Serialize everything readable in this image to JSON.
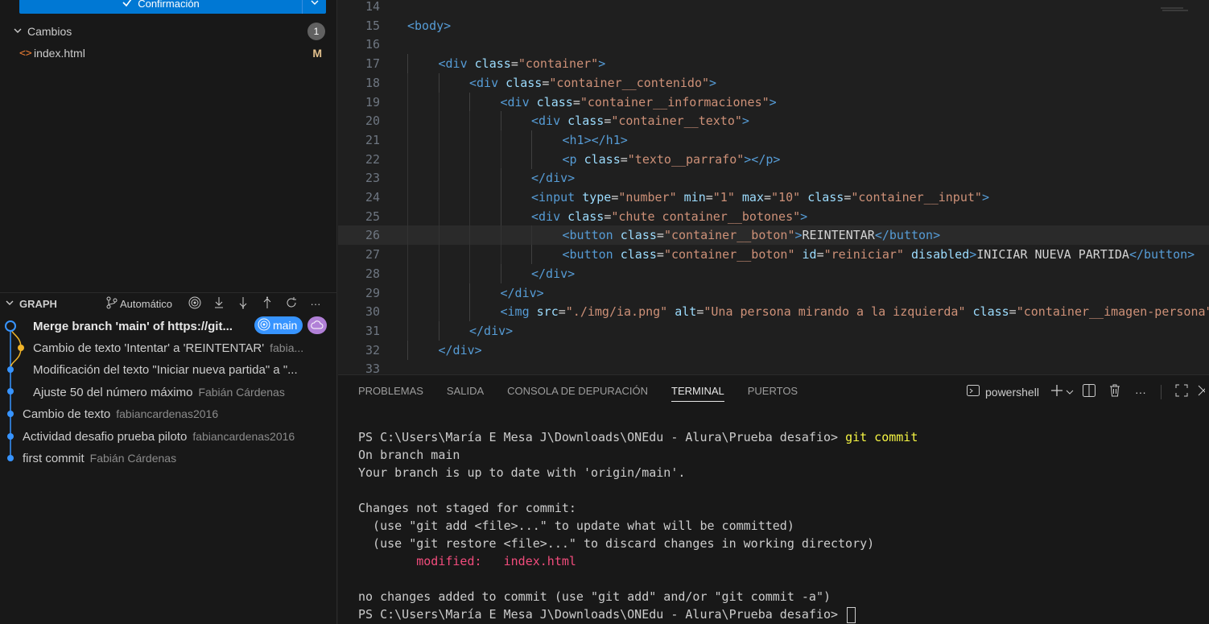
{
  "sidebar": {
    "commit_button": "Confirmación",
    "changes": {
      "label": "Cambios",
      "count": "1"
    },
    "files": [
      {
        "name": "index.html",
        "status": "M"
      }
    ],
    "graph": {
      "title": "GRAPH",
      "mode": "Automático",
      "branch": "main",
      "commits": [
        {
          "message": "Merge branch 'main' of https://git...",
          "author": ""
        },
        {
          "message": "Cambio de texto 'Intentar' a 'REINTENTAR'",
          "author": "fabia..."
        },
        {
          "message": "Modificación del texto \"Iniciar nueva partida\" a \"...",
          "author": ""
        },
        {
          "message": "Ajuste 50 del número máximo",
          "author": "Fabián Cárdenas"
        },
        {
          "message": "Cambio de texto",
          "author": "fabiancardenas2016"
        },
        {
          "message": "Actividad desafio prueba piloto",
          "author": "fabiancardenas2016"
        },
        {
          "message": "first commit",
          "author": "Fabián Cárdenas"
        }
      ]
    }
  },
  "editor": {
    "lines": [
      {
        "n": "14",
        "indent": 0,
        "tokens": []
      },
      {
        "n": "15",
        "indent": 0,
        "tokens": [
          [
            "tag",
            "<body>"
          ]
        ]
      },
      {
        "n": "16",
        "indent": 0,
        "tokens": []
      },
      {
        "n": "17",
        "indent": 1,
        "tokens": [
          [
            "tag",
            "<div "
          ],
          [
            "attr",
            "class"
          ],
          [
            "txt",
            "="
          ],
          [
            "str",
            "\"container\""
          ],
          [
            "tag",
            ">"
          ]
        ]
      },
      {
        "n": "18",
        "indent": 2,
        "tokens": [
          [
            "tag",
            "<div "
          ],
          [
            "attr",
            "class"
          ],
          [
            "txt",
            "="
          ],
          [
            "str",
            "\"container__contenido\""
          ],
          [
            "tag",
            ">"
          ]
        ]
      },
      {
        "n": "19",
        "indent": 3,
        "tokens": [
          [
            "tag",
            "<div "
          ],
          [
            "attr",
            "class"
          ],
          [
            "txt",
            "="
          ],
          [
            "str",
            "\"container__informaciones\""
          ],
          [
            "tag",
            ">"
          ]
        ]
      },
      {
        "n": "20",
        "indent": 4,
        "tokens": [
          [
            "tag",
            "<div "
          ],
          [
            "attr",
            "class"
          ],
          [
            "txt",
            "="
          ],
          [
            "str",
            "\"container__texto\""
          ],
          [
            "tag",
            ">"
          ]
        ]
      },
      {
        "n": "21",
        "indent": 5,
        "tokens": [
          [
            "tag",
            "<h1></h1>"
          ]
        ]
      },
      {
        "n": "22",
        "indent": 5,
        "tokens": [
          [
            "tag",
            "<p "
          ],
          [
            "attr",
            "class"
          ],
          [
            "txt",
            "="
          ],
          [
            "str",
            "\"texto__parrafo\""
          ],
          [
            "tag",
            "></p>"
          ]
        ]
      },
      {
        "n": "23",
        "indent": 4,
        "tokens": [
          [
            "tag",
            "</div>"
          ]
        ]
      },
      {
        "n": "24",
        "indent": 4,
        "tokens": [
          [
            "tag",
            "<input "
          ],
          [
            "attr",
            "type"
          ],
          [
            "txt",
            "="
          ],
          [
            "str",
            "\"number\""
          ],
          [
            "txt",
            " "
          ],
          [
            "attr",
            "min"
          ],
          [
            "txt",
            "="
          ],
          [
            "str",
            "\"1\""
          ],
          [
            "txt",
            " "
          ],
          [
            "attr",
            "max"
          ],
          [
            "txt",
            "="
          ],
          [
            "str",
            "\"10\""
          ],
          [
            "txt",
            " "
          ],
          [
            "attr",
            "class"
          ],
          [
            "txt",
            "="
          ],
          [
            "str",
            "\"container__input\""
          ],
          [
            "tag",
            ">"
          ]
        ]
      },
      {
        "n": "25",
        "indent": 4,
        "tokens": [
          [
            "tag",
            "<div "
          ],
          [
            "attr",
            "class"
          ],
          [
            "txt",
            "="
          ],
          [
            "str",
            "\"chute container__botones\""
          ],
          [
            "tag",
            ">"
          ]
        ]
      },
      {
        "n": "26",
        "indent": 5,
        "tokens": [
          [
            "tag",
            "<button "
          ],
          [
            "attr",
            "class"
          ],
          [
            "txt",
            "="
          ],
          [
            "str",
            "\"container__boton\""
          ],
          [
            "tag",
            ">"
          ],
          [
            "txt",
            "REINTENTAR"
          ],
          [
            "tag",
            "</button>"
          ]
        ]
      },
      {
        "n": "27",
        "indent": 5,
        "tokens": [
          [
            "tag",
            "<button "
          ],
          [
            "attr",
            "class"
          ],
          [
            "txt",
            "="
          ],
          [
            "str",
            "\"container__boton\""
          ],
          [
            "txt",
            " "
          ],
          [
            "attr",
            "id"
          ],
          [
            "txt",
            "="
          ],
          [
            "str",
            "\"reiniciar\""
          ],
          [
            "txt",
            " "
          ],
          [
            "attr",
            "disabled"
          ],
          [
            "tag",
            ">"
          ],
          [
            "txt",
            "INICIAR NUEVA PARTIDA"
          ],
          [
            "tag",
            "</button>"
          ]
        ]
      },
      {
        "n": "28",
        "indent": 4,
        "tokens": [
          [
            "tag",
            "</div>"
          ]
        ]
      },
      {
        "n": "29",
        "indent": 3,
        "tokens": [
          [
            "tag",
            "</div>"
          ]
        ]
      },
      {
        "n": "30",
        "indent": 3,
        "tokens": [
          [
            "tag",
            "<img "
          ],
          [
            "attr",
            "src"
          ],
          [
            "txt",
            "="
          ],
          [
            "str",
            "\"./img/ia.png\""
          ],
          [
            "txt",
            " "
          ],
          [
            "attr",
            "alt"
          ],
          [
            "txt",
            "="
          ],
          [
            "str",
            "\"Una persona mirando a la izquierda\""
          ],
          [
            "txt",
            " "
          ],
          [
            "attr",
            "class"
          ],
          [
            "txt",
            "="
          ],
          [
            "str",
            "\"container__imagen-persona\""
          ],
          [
            "tag",
            ">"
          ]
        ]
      },
      {
        "n": "31",
        "indent": 2,
        "tokens": [
          [
            "tag",
            "</div>"
          ]
        ]
      },
      {
        "n": "32",
        "indent": 1,
        "tokens": [
          [
            "tag",
            "</div>"
          ]
        ]
      },
      {
        "n": "33",
        "indent": 0,
        "tokens": []
      }
    ]
  },
  "panel": {
    "tabs": [
      "PROBLEMAS",
      "SALIDA",
      "CONSOLA DE DEPURACIÓN",
      "TERMINAL",
      "PUERTOS"
    ],
    "active_tab": "TERMINAL",
    "shell": "powershell",
    "terminal": {
      "prompt": "PS C:\\Users\\María E Mesa J\\Downloads\\ONEdu - Alura\\Prueba desafio>",
      "command": "git commit",
      "output": [
        "On branch main",
        "Your branch is up to date with 'origin/main'.",
        "",
        "Changes not staged for commit:",
        "  (use \"git add <file>...\" to update what will be committed)",
        "  (use \"git restore <file>...\" to discard changes in working directory)"
      ],
      "modified_label": "modified:",
      "modified_file": "index.html",
      "footer": "no changes added to commit (use \"git add\" and/or \"git commit -a\")"
    }
  }
}
